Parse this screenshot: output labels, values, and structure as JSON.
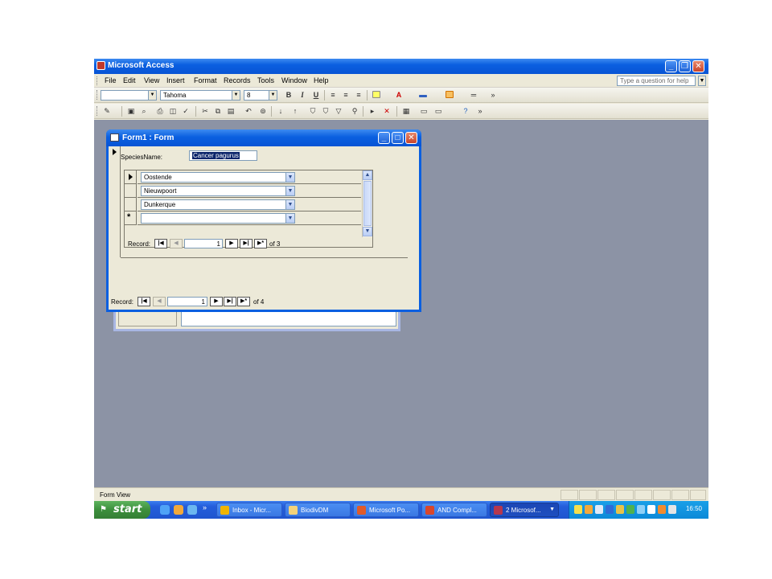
{
  "app": {
    "title": "Microsoft Access",
    "window_buttons": [
      "_",
      "❐",
      "✕"
    ]
  },
  "menu": {
    "items": [
      "File",
      "Edit",
      "View",
      "Insert",
      "Format",
      "Records",
      "Tools",
      "Window",
      "Help"
    ],
    "ask_placeholder": "Type a question for help"
  },
  "format_toolbar": {
    "font_name": "Tahoma",
    "font_size": "8",
    "bold": "B",
    "italic": "I",
    "underline": "U"
  },
  "form_window": {
    "title": "Form1 : Form",
    "species_label": "SpeciesName:",
    "species_value": "Cancer pagurus",
    "subform_rows": [
      "Oostende",
      "Nieuwpoort",
      "Dunkerque",
      ""
    ],
    "new_record_marker": "*",
    "sub_nav": {
      "label": "Record:",
      "current": "1",
      "of_text": "of  3"
    },
    "main_nav": {
      "label": "Record:",
      "current": "1",
      "of_text": "of  4"
    },
    "nav_buttons": {
      "first": "|◀",
      "prev": "◀",
      "next": "▶",
      "last": "▶|",
      "new": "▶*"
    }
  },
  "status_bar": {
    "text": "Form View"
  },
  "taskbar": {
    "start_label": "start",
    "tasks": [
      {
        "label": "Inbox - Micr...",
        "color": "#f0b400"
      },
      {
        "label": "BiodivDM",
        "color": "#f3d27a"
      },
      {
        "label": "Microsoft Po...",
        "color": "#e05a2a"
      },
      {
        "label": "AND Compl...",
        "color": "#d9462b"
      },
      {
        "label": "2 Microsof...",
        "color": "#b5374e"
      }
    ],
    "clock": "16:50"
  }
}
